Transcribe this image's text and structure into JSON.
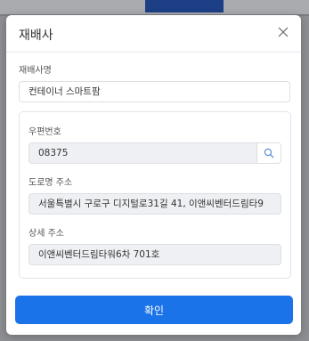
{
  "modal": {
    "title": "재배사",
    "close_icon": "close-icon"
  },
  "form": {
    "name_label": "재배사명",
    "name_value": "컨테이너 스마트팜",
    "postal_label": "우편번호",
    "postal_value": "08375",
    "search_icon": "search-icon",
    "road_label": "도로명 주소",
    "road_value": "서울특별시 구로구 디지털로31길 41, 이앤씨벤터드림타9",
    "detail_label": "상세 주소",
    "detail_value": "이앤씨벤터드림타워6차 701호"
  },
  "footer": {
    "confirm_label": "확인"
  },
  "colors": {
    "primary": "#1a73e8",
    "overlay": "#8d8f93",
    "header_tab": "#1c3f86"
  }
}
